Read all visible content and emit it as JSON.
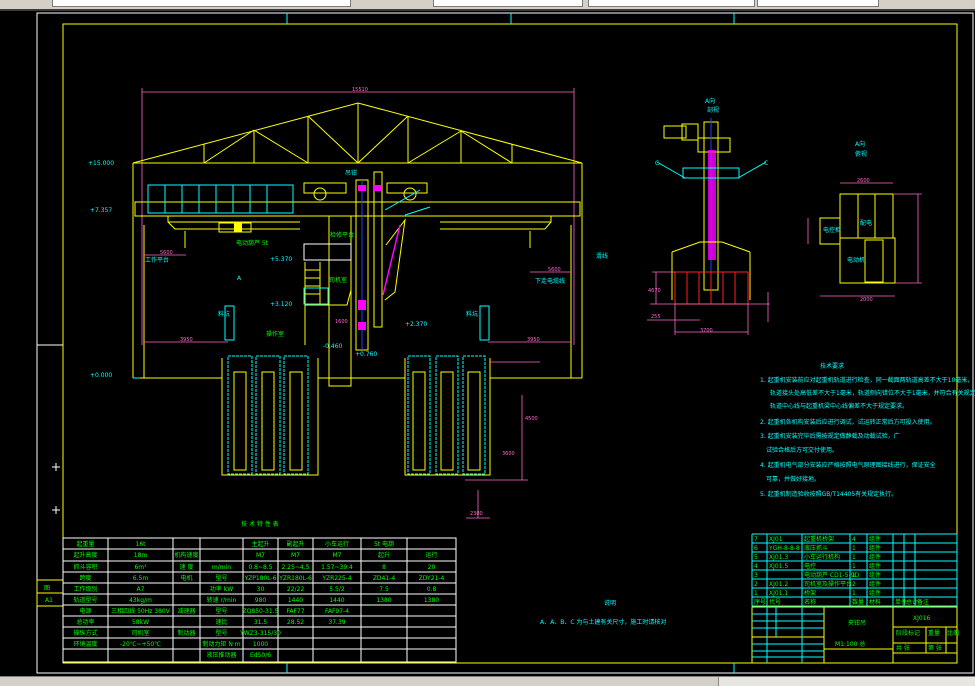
{
  "colors": {
    "background": "#000000",
    "frame": "#ffffff",
    "border": "#ffff00",
    "dimension": "#ff66cc",
    "annotation": "#00ffff",
    "table_text": "#00ff00"
  },
  "main_view": {
    "overall_dim": "15510",
    "elevations": [
      "+15.000",
      "+7.357",
      "+0.000",
      "+5.370",
      "+3.120",
      "-0.460",
      "+0.760",
      "+2.370"
    ],
    "labels": [
      "吊钳",
      "检修平台",
      "电动葫芦 5t",
      "司机室",
      "操作室",
      "料坑",
      "料坑",
      "料坑",
      "工作平台",
      "滑线",
      "下走电缆线"
    ],
    "section_mark": "A",
    "dims": [
      "5600",
      "5600",
      "3950",
      "3950",
      "1600",
      "1600",
      "1200",
      "4500",
      "3600",
      "2300"
    ]
  },
  "side_view": {
    "title": "A向",
    "subtitle": "剖视",
    "marks": [
      "C",
      "C"
    ],
    "dims": [
      "3700",
      "4670",
      "1450",
      "3300",
      "255"
    ]
  },
  "plan_view": {
    "title": "A向",
    "subtitle": "俯视",
    "labels": [
      "电控柜",
      "配电",
      "电动机"
    ],
    "dims": [
      "2600",
      "1200",
      "3600",
      "3900",
      "2000",
      "3500"
    ]
  },
  "tech_table": {
    "title": "技 术 特 性 表",
    "rows": [
      [
        "起重量",
        "16t",
        "",
        "主起升",
        "副起升",
        "小车运行",
        "5t 电葫",
        ""
      ],
      [
        "起升高度",
        "18m",
        "机构速度",
        "M7",
        "M7",
        "M7",
        "起升",
        "运行"
      ],
      [
        "抓斗容积",
        "6m³",
        "速 度",
        "m/min",
        "0.8~8.5",
        "2.25~4.5",
        "1.57~39.4",
        "8",
        "20"
      ],
      [
        "跨度",
        "6.5m",
        "电机",
        "型号",
        "YZP180L-6",
        "YZR180L-6",
        "YZR225-4",
        "ZD41-4",
        "ZDY21-4"
      ],
      [
        "工作级别",
        "A7",
        "",
        "功率 kW",
        "30",
        "22/22",
        "5.5/2",
        "7.5",
        "0.8"
      ],
      [
        "轨道型号",
        "43kg/m",
        "",
        "转速 r/min",
        "980",
        "1440",
        "1440",
        "1380",
        "1380"
      ],
      [
        "电源",
        "三相四线 50Hz 380V",
        "减速器",
        "型号",
        "ZQ850-31.5",
        "FAF77",
        "FAF97-4"
      ],
      [
        "总功率",
        "58kW",
        "",
        "速比",
        "31.5",
        "28.52",
        "37.39"
      ],
      [
        "操纵方式",
        "司机室",
        "制动器",
        "型号",
        "YWZ3-315/30"
      ],
      [
        "环境温度",
        "-20℃~+50℃",
        "",
        "制动力矩 N·m",
        "1000"
      ],
      [
        "",
        "",
        "",
        "液压推动器",
        "Ed50/6"
      ]
    ]
  },
  "notes": {
    "title": "技术要求",
    "items": [
      "1. 起重机安装前应对起重机轨道进行检查，同一截面两轨道高差不大于10毫米，",
      "轨道接头处高低差不大于1毫米，轨道侧向错位不大于1毫米，并符合有关规定，",
      "轨道中心线与起重机梁中心线偏差不大于规定要求。",
      "2. 起重机各机构安装后应进行调试，试运转正常后方可投入使用。",
      "3. 起重机安装完毕后需按规定做静载及动载试验，广",
      "试验合格后方可交付使用。",
      "4. 起重机电气部分安装应严格按照电气原理图接线进行，保证安全",
      "可靠，并做好接地。",
      "5. 起重机制造验收按照GB/T14405有关规定执行。"
    ]
  },
  "explanation": {
    "title": "说明",
    "text": "A、A、B、C 为与土建有关尺寸，施工时请核对"
  },
  "parts_list": {
    "rows": [
      [
        "7",
        "XJ01",
        "起重机桥架",
        "4",
        "组件",
        "",
        ""
      ],
      [
        "6",
        "YGH-8-8-8",
        "液压抓斗",
        "1",
        "组件",
        "",
        ""
      ],
      [
        "5",
        "XJ01.3",
        "小车运行机构",
        "1",
        "组件",
        "",
        ""
      ],
      [
        "4",
        "XJ01.5",
        "电控",
        "1",
        "组件",
        "",
        ""
      ],
      [
        "3",
        "",
        "电动葫芦 CD1-5-9D",
        "1",
        "组件",
        "",
        ""
      ],
      [
        "2",
        "XJ01.2",
        "司机室及操作平台",
        "2",
        "组件",
        "",
        ""
      ],
      [
        "1",
        "XJ01.1",
        "桥架",
        "1",
        "组件",
        "",
        ""
      ]
    ],
    "header": [
      "序号",
      "代号",
      "名称",
      "数量",
      "材料",
      "单件",
      "总计",
      "备注"
    ]
  },
  "title_block": {
    "drawing_name": "夹钳吊",
    "drawing_no": "XJ016",
    "scale_note": "M1:100 总",
    "sheet": "共 张",
    "sheet2": "第 张",
    "stage": "阶段标记",
    "weight": "重量",
    "scale": "比例"
  },
  "frame": {
    "size_label": "A1",
    "zone": "图"
  }
}
